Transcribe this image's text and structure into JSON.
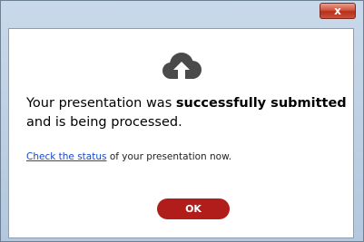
{
  "dialog": {
    "close_label": "x",
    "message_prefix": "Your presentation was",
    "message_bold": "successfully submitted",
    "message_suffix": "and is being processed.",
    "status_link": "Check the status",
    "status_suffix": "of your presentation now.",
    "ok_label": "OK"
  },
  "colors": {
    "accent": "#b01d1b",
    "link": "#1a47c6",
    "cloud": "#4a4a4a"
  },
  "icons": {
    "upload": "cloud-upload-icon"
  }
}
